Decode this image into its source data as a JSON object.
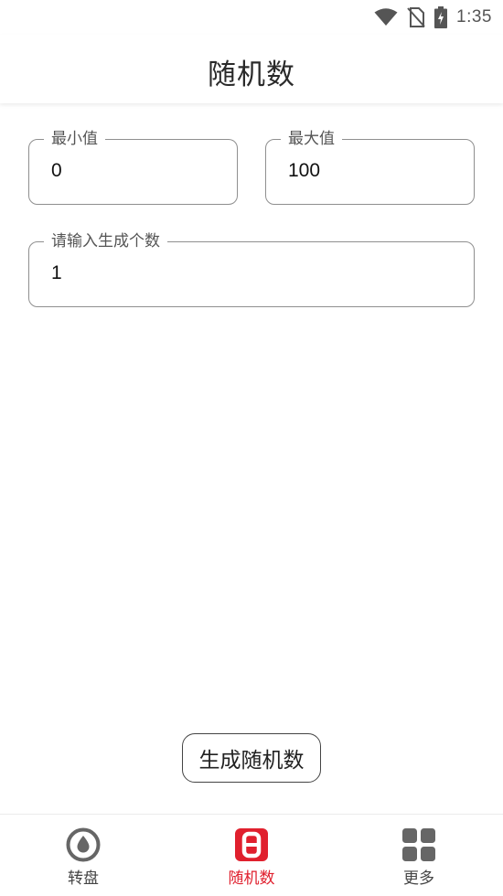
{
  "status_bar": {
    "time": "1:35"
  },
  "app_bar": {
    "title": "随机数"
  },
  "form": {
    "min": {
      "label": "最小值",
      "value": "0"
    },
    "max": {
      "label": "最大值",
      "value": "100"
    },
    "count": {
      "label": "请输入生成个数",
      "value": "1"
    }
  },
  "actions": {
    "generate_label": "生成随机数"
  },
  "bottom_nav": {
    "items": [
      {
        "label": "转盘",
        "icon": "wheel-icon",
        "active": false
      },
      {
        "label": "随机数",
        "icon": "dice-eight-icon",
        "active": true
      },
      {
        "label": "更多",
        "icon": "grid-icon",
        "active": false
      }
    ]
  },
  "colors": {
    "accent": "#e0202e",
    "icon_gray": "#666666",
    "border": "#8f8f8f"
  }
}
